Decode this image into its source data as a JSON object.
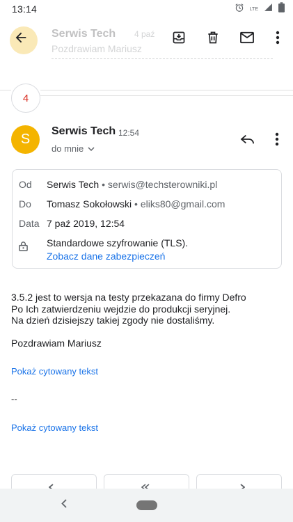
{
  "status_bar": {
    "time": "13:14",
    "network": "LTE",
    "icons": [
      "alarm-icon",
      "signal-icon",
      "battery-icon"
    ]
  },
  "toolbar": {
    "icons": [
      "back-arrow-icon",
      "archive-icon",
      "delete-icon",
      "mail-icon",
      "more-vert-icon"
    ]
  },
  "collapsed_previous": {
    "sender": "Serwis Tech",
    "count": "4 paź",
    "snippet": "Pozdrawiam Mariusz"
  },
  "collapsed_count": "4",
  "message": {
    "avatar_letter": "S",
    "avatar_color": "#f4b400",
    "sender": "Serwis Tech",
    "time": "12:54",
    "recipient_summary": "do mnie",
    "details": {
      "from_label": "Od",
      "from_name": "Serwis Tech",
      "from_email": "serwis@techsterowniki.pl",
      "to_label": "Do",
      "to_name": "Tomasz Sokołowski",
      "to_email": "eliks80@gmail.com",
      "date_label": "Data",
      "date_value": "7 paź 2019, 12:54",
      "security_text": "Standardowe szyfrowanie (TLS).",
      "security_link": "Zobacz dane zabezpieczeń"
    },
    "body_lines": [
      " 3.5.2 jest to wersja na testy przekazana do firmy Defro",
      "Po Ich zatwierdzeniu wejdzie do produkcji seryjnej.",
      "Na dzień dzisiejszy takiej zgody nie dostaliśmy."
    ],
    "signature": "Pozdrawiam Mariusz",
    "show_quoted_1": "Pokaż cytowany tekst",
    "separator": "--",
    "show_quoted_2": "Pokaż cytowany tekst"
  },
  "colors": {
    "accent_link": "#1a73e8",
    "count_red": "#d93025",
    "muted": "#5f6368"
  }
}
